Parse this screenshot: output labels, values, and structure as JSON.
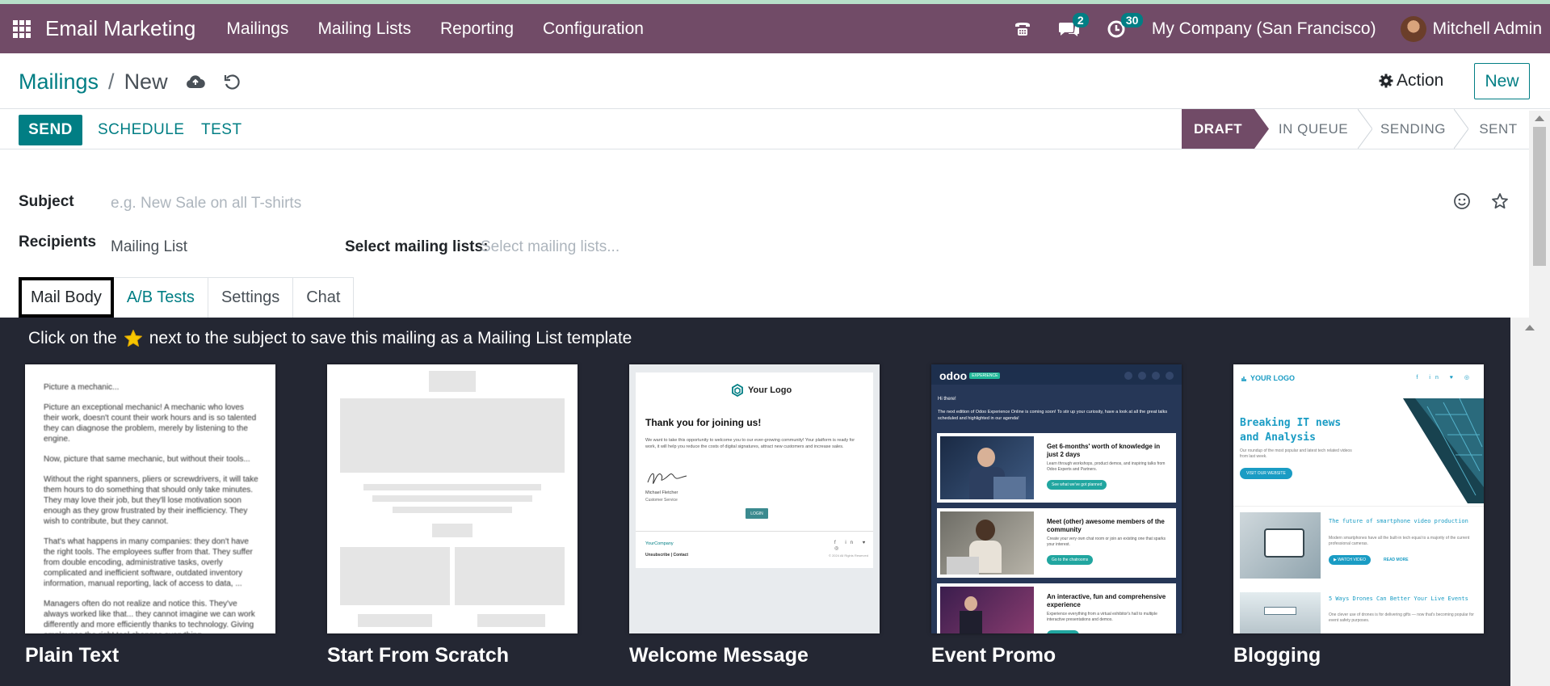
{
  "navbar": {
    "app_name": "Email Marketing",
    "menu": [
      "Mailings",
      "Mailing Lists",
      "Reporting",
      "Configuration"
    ],
    "messages_count": "2",
    "activities_count": "30",
    "company": "My Company (San Francisco)",
    "user": "Mitchell Admin",
    "colors": {
      "background": "#714b67",
      "badge": "#017e84"
    }
  },
  "breadcrumb": {
    "parent": "Mailings",
    "separator": "/",
    "current": "New"
  },
  "control": {
    "action_label": "Action",
    "new_label": "New"
  },
  "statusbar": {
    "send_label": "SEND",
    "schedule_label": "SCHEDULE",
    "test_label": "TEST",
    "stages": [
      "DRAFT",
      "IN QUEUE",
      "SENDING",
      "SENT"
    ],
    "active_stage": "DRAFT"
  },
  "form": {
    "subject_label": "Subject",
    "subject_placeholder": "e.g. New Sale on all T-shirts",
    "recipients_label": "Recipients",
    "recipients_value": "Mailing List",
    "mailing_lists_label": "Select mailing lists:",
    "mailing_lists_placeholder": "Select mailing lists..."
  },
  "tabs": [
    "Mail Body",
    "A/B Tests",
    "Settings",
    "Chat"
  ],
  "templates_area": {
    "hint_before": "Click on the",
    "hint_after": "next to the subject to save this mailing as a Mailing List template",
    "templates": [
      {
        "name": "Plain Text",
        "paragraphs": [
          "Picture a mechanic...",
          "Picture an exceptional mechanic! A mechanic who loves their work, doesn't count their work hours and is so talented they can diagnose the problem, merely by listening to the engine.",
          "Now, picture that same mechanic, but without their tools...",
          "Without the right spanners, pliers or screwdrivers, it will take them hours to do something that should only take minutes. They may love their job, but they'll lose motivation soon enough as they grow frustrated by their inefficiency. They wish to contribute, but they cannot.",
          "That's what happens in many companies: they don't have the right tools. The employees suffer from that. They suffer from double encoding, administrative tasks, overly complicated and inefficient software, outdated inventory information, manual reporting, lack of access to data, ...",
          "Managers often do not realize and notice this. They've always worked like that... they cannot imagine we can work differently and more efficiently thanks to technology. Giving employees the right tool changes everything."
        ]
      },
      {
        "name": "Start From Scratch"
      },
      {
        "name": "Welcome Message",
        "logo": "Your Logo",
        "heading": "Thank you for joining us!",
        "body": "We want to take this opportunity to welcome you to our ever-growing community! Your platform is ready for work, it will help you reduce the costs of digital signatures, attract new customers and increase sales.",
        "signer": "Michael Fletcher",
        "signer_title": "Customer Service",
        "button": "LOGIN",
        "footer_company": "YourCompany",
        "footer_links": "Unsubscribe | Contact",
        "footer_copy": "© 2024 All Rights Reserved"
      },
      {
        "name": "Event Promo",
        "logo": "odoo",
        "logo_tag": "EXPERIENCE",
        "greeting": "Hi there!",
        "intro": "The next edition of Odoo Experience Online is coming soon! To stir up your curiosity, have a look at all the great talks scheduled and highlighted in our agenda!",
        "cards": [
          {
            "title": "Get 6-months' worth of knowledge in just 2 days",
            "text": "Learn through workshops, product demos, and inspiring talks from Odoo Experts and Partners.",
            "button": "See what we've got planned"
          },
          {
            "title": "Meet (other) awesome members of the community",
            "text": "Create your very own chat room or join an existing one that sparks your interest.",
            "button": "Go to the chatrooms"
          },
          {
            "title": "An interactive, fun and comprehensive experience",
            "text": "Experience everything from a virtual exhibitor's hall to multiple interactive presentations and demos.",
            "button": ""
          }
        ]
      },
      {
        "name": "Blogging",
        "logo": "YOUR LOGO",
        "headline": "Breaking IT news and Analysis",
        "subtext": "Our roundup of the most popular and latest tech related videos from last week.",
        "button": "VISIT OUR WEBSITE",
        "articles": [
          {
            "title": "The future of smartphone video production",
            "text": "Modern smartphones have all the built-in tech equal to a majority of the current professional cameras.",
            "button": "WATCH VIDEO",
            "more": "READ MORE"
          },
          {
            "title": "5 Ways Drones Can Better Your Live Events",
            "text": "One clever use of drones is for delivering gifts — now that's becoming popular for event safety purposes."
          }
        ]
      }
    ]
  }
}
